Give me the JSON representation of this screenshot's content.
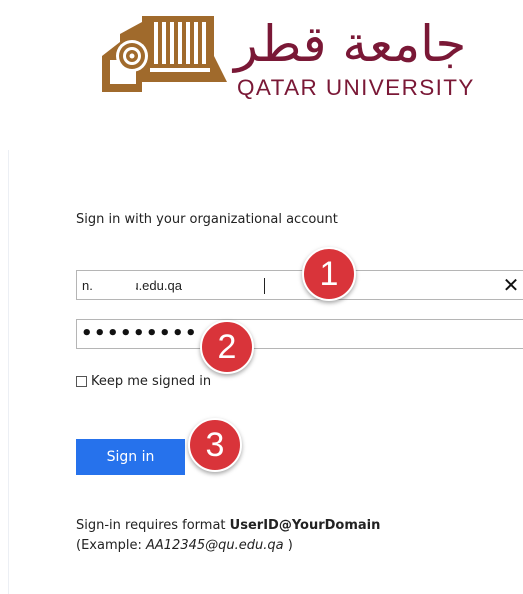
{
  "branding": {
    "arabic_name": "جامعة قطر",
    "english_name": "QATAR UNIVERSITY",
    "brand_color": "#7a1836",
    "emblem_color": "#a06a2c"
  },
  "form": {
    "prompt": "Sign in with your organizational account",
    "username_value": "n.   40@qu.edu.qa",
    "password_mask": "•••••••••",
    "clear_glyph": "✕",
    "keep_signed_in_label": "Keep me signed in",
    "keep_signed_in_checked": false,
    "sign_in_label": "Sign in",
    "sign_in_color": "#2672ec"
  },
  "help": {
    "prefix": "Sign-in requires format ",
    "format": "UserID@YourDomain",
    "example_open": "(Example: ",
    "example_value": "AA12345@qu.edu.qa",
    "example_close": " )"
  },
  "annotations": [
    {
      "label": "1"
    },
    {
      "label": "2"
    },
    {
      "label": "3"
    }
  ],
  "annotation_color": "#d9343a"
}
